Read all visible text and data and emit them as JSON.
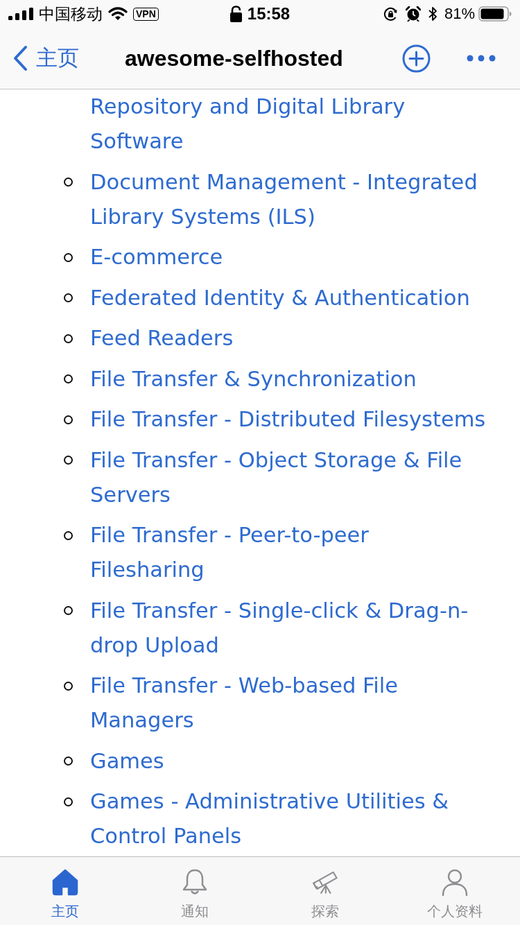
{
  "status_bar": {
    "carrier": "中国移动",
    "vpn": "VPN",
    "time": "15:58",
    "battery": "81%"
  },
  "nav_bar": {
    "back": "主页",
    "title": "awesome-selfhosted"
  },
  "list": {
    "continued_item": "Repository and Digital Library Software",
    "items": [
      "Document Management - Integrated Library Systems (ILS)",
      "E-commerce",
      "Federated Identity & Authentication",
      "Feed Readers",
      "File Transfer & Synchronization",
      "File Transfer - Distributed Filesystems",
      "File Transfer - Object Storage & File Servers",
      "File Transfer - Peer-to-peer Filesharing",
      "File Transfer - Single-click & Drag-n-drop Upload",
      "File Transfer - Web-based File Managers",
      "Games",
      "Games - Administrative Utilities & Control Panels"
    ]
  },
  "tab_bar": [
    {
      "label": "主页",
      "selected": true
    },
    {
      "label": "通知",
      "selected": false
    },
    {
      "label": "探索",
      "selected": false
    },
    {
      "label": "个人资料",
      "selected": false
    }
  ]
}
